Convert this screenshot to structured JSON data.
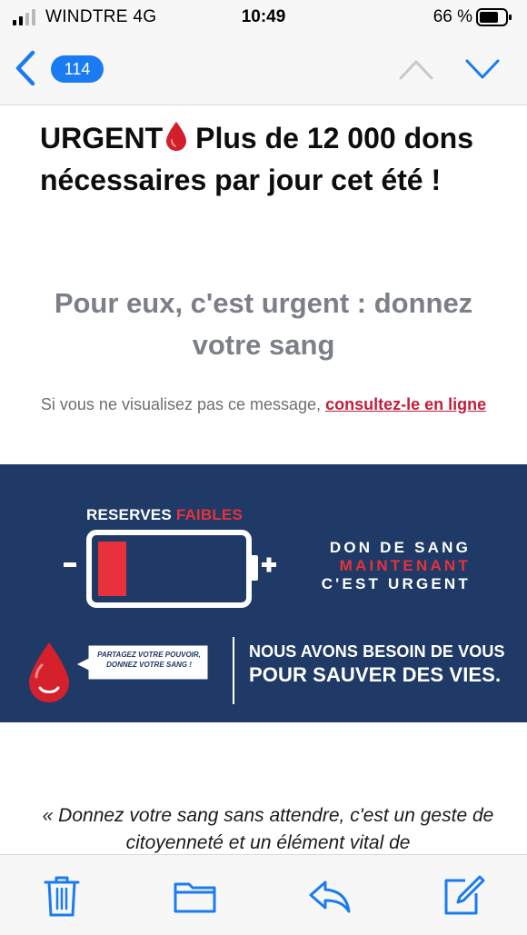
{
  "status_bar": {
    "carrier": "WINDTRE  4G",
    "time": "10:49",
    "battery_percent": "66 %"
  },
  "nav": {
    "unread_count": "114",
    "back_icon": "chevron-left-icon",
    "up_icon": "chevron-up-icon",
    "down_icon": "chevron-down-icon"
  },
  "email": {
    "headline_part1": "URGENT",
    "headline_part2": "Plus de 12 000 dons nécessaires par jour cet été !",
    "subheadline": "Pour eux, c'est urgent : donnez votre sang",
    "online_note_prefix": "Si vous ne visualisez pas ce message, ",
    "online_link": "consultez-le en ligne",
    "banner": {
      "reserves_word": "RESERVES ",
      "faibles_word": "FAIBLES",
      "don_line1": "DON DE SANG",
      "don_line2": "MAINTENANT",
      "don_line3": "C'EST URGENT",
      "bubble_line1": "PARTAGEZ VOTRE POUVOIR,",
      "bubble_line2": "DONNEZ VOTRE SANG !",
      "need_line1": "NOUS AVONS BESOIN DE VOUS",
      "need_line2": "POUR SAUVER DES VIES.",
      "battery_level": 0.2
    },
    "quote": "« Donnez votre sang sans attendre, c'est un geste de citoyenneté et un élément vital de"
  },
  "toolbar": {
    "icons": [
      "trash-icon",
      "folder-icon",
      "reply-icon",
      "compose-icon"
    ]
  },
  "colors": {
    "accent_blue": "#1a7bf2",
    "banner_navy": "#1f3a66",
    "alert_red": "#e8313a",
    "link_red": "#c41d3a"
  }
}
